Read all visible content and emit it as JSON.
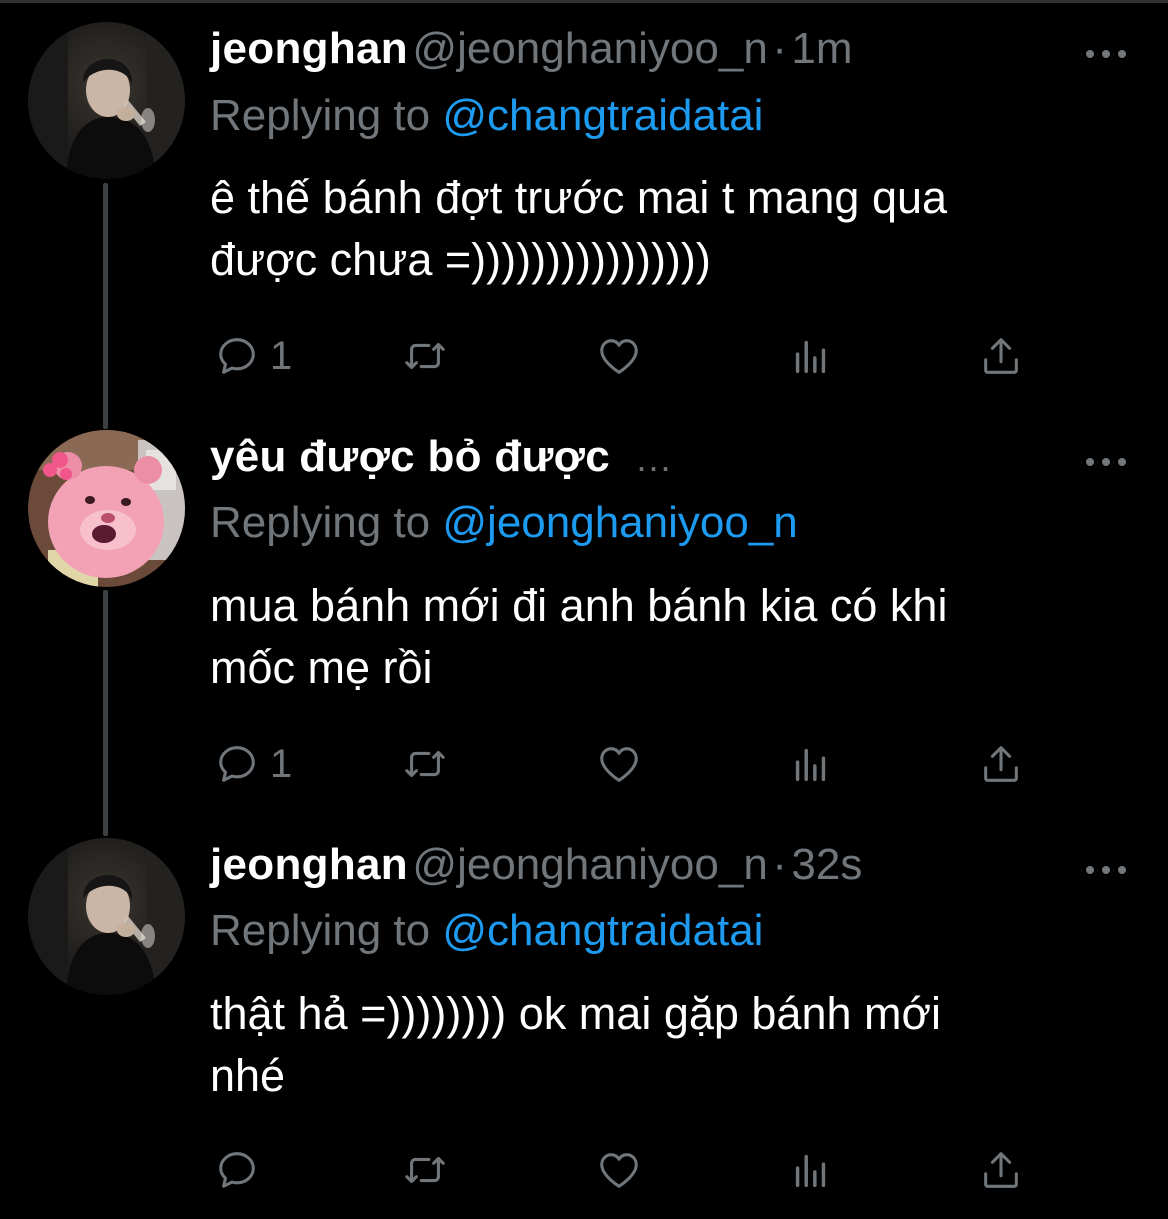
{
  "tweets": [
    {
      "display_name": "jeonghan",
      "handle": "@jeonghaniyoo_n",
      "separator": "·",
      "time": "1m",
      "replying_prefix": "Replying to",
      "replying_to": "@changtraidatai",
      "text_line1": "ê thế bánh đợt trước mai t mang qua",
      "text_line2": "được chưa =))))))))))))))))",
      "reply_count": "1",
      "avatar_icon": "person-avatar"
    },
    {
      "display_name": "yêu được bỏ được",
      "name_suffix": "...",
      "replying_prefix": "Replying to",
      "replying_to": "@jeonghaniyoo_n",
      "text_line1": "mua bánh mới đi anh bánh kia có khi",
      "text_line2": "mốc mẹ rồi",
      "reply_count": "1",
      "avatar_icon": "pink-bear-avatar"
    },
    {
      "display_name": "jeonghan",
      "handle": "@jeonghaniyoo_n",
      "separator": "·",
      "time": "32s",
      "replying_prefix": "Replying to",
      "replying_to": "@changtraidatai",
      "text_line1": "thật hả =)))))))) ok mai gặp bánh mới",
      "text_line2": "nhé",
      "reply_count": "",
      "avatar_icon": "person-avatar"
    }
  ],
  "colors": {
    "background": "#000000",
    "text_primary": "#ffffff",
    "text_secondary": "#71767b",
    "accent": "#1d9bf0",
    "thread_line": "#3e4144"
  },
  "icons": [
    "reply-icon",
    "retweet-icon",
    "like-icon",
    "views-icon",
    "share-icon",
    "more-icon"
  ]
}
